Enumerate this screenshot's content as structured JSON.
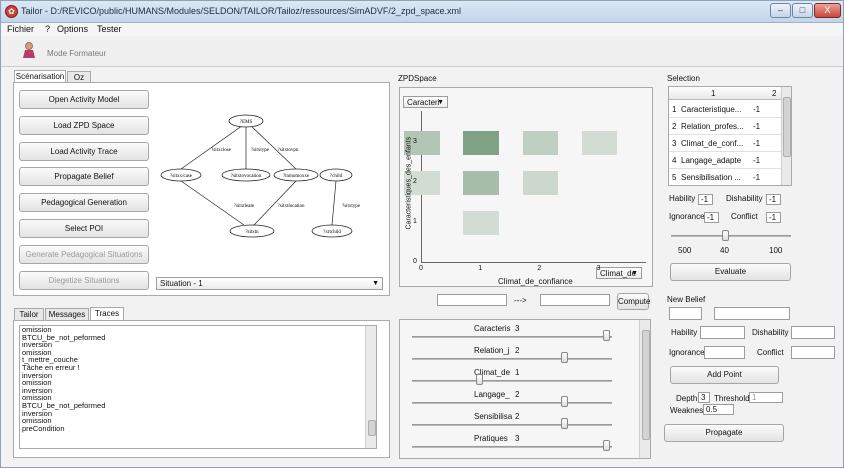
{
  "window": {
    "title": "Tailor - D:/REVICO/public/HUMANS/Modules/SELDON/TAILOR/Tailoz/ressources/SimADVF/2_zpd_space.xml",
    "controls": [
      "–",
      "□",
      "X"
    ]
  },
  "menu": [
    "Fichier",
    "?",
    "Options",
    "Tester"
  ],
  "toolbar": {
    "mode_label": "Mode Formateur"
  },
  "left_tabs": [
    "Scénarisation",
    "Oz"
  ],
  "actions": [
    {
      "label": "Open Activity Model",
      "enabled": true
    },
    {
      "label": "Load ZPD Space",
      "enabled": true
    },
    {
      "label": "Load Activity Trace",
      "enabled": true
    },
    {
      "label": "Propagate Belief",
      "enabled": true
    },
    {
      "label": "Pedagogical Generation",
      "enabled": true
    },
    {
      "label": "Select POI",
      "enabled": true
    },
    {
      "label": "Generate Pedagogical Situations",
      "enabled": false
    },
    {
      "label": "Diegetize Situations",
      "enabled": false
    }
  ],
  "situation_select": "Situation - 1",
  "graph": {
    "nodes": [
      "?EMS",
      "?sitxx/case",
      "?sitxtovocation",
      "?inmomoxxe",
      "?child",
      "?sitxtn",
      "?xrtchild"
    ],
    "edges": [
      "?sitxclose",
      "?sitxtype",
      "?sitxtovpn",
      "?sitxtleate",
      "?sitxtlocation",
      "?sitxtype"
    ]
  },
  "bottom_tabs": [
    "Tailor",
    "Messages",
    "Traces"
  ],
  "traces": [
    "omission",
    "BTCU_be_not_peformed",
    "inversion",
    "omission",
    "t_mettre_couche",
    "Tâche en erreur !",
    "inversion",
    "omission",
    "inversion",
    "omission",
    "BTCU_be_not_peformed",
    "inversion",
    "omission",
    "preCondition"
  ],
  "zpd": {
    "title": "ZPDSpace",
    "ycombo": "Caracteri",
    "xcombo": "Climat_de",
    "ylabel": "Caracteristiques_des_enfants",
    "xlabel": "Climat_de_confiance",
    "xticks": [
      "0",
      "1",
      "2",
      "3"
    ],
    "yticks": [
      "0",
      "1",
      "2",
      "3"
    ],
    "arrow": "--->",
    "compute_label": "Compute",
    "cells": [
      {
        "x": 1,
        "y": 3,
        "level": 0.85
      },
      {
        "x": 2,
        "y": 3,
        "level": 0.35
      },
      {
        "x": 3,
        "y": 3,
        "level": 0.2
      },
      {
        "x": 0,
        "y": 3,
        "level": 0.45
      },
      {
        "x": 1,
        "y": 2,
        "level": 0.55
      },
      {
        "x": 2,
        "y": 2,
        "level": 0.25
      },
      {
        "x": 0,
        "y": 2,
        "level": 0.2
      },
      {
        "x": 1,
        "y": 1,
        "level": 0.2
      }
    ]
  },
  "sliders": [
    {
      "label": "Caracteris",
      "value": "3",
      "pos": 1.0
    },
    {
      "label": "Relation_j",
      "value": "2",
      "pos": 0.67
    },
    {
      "label": "Climat_de",
      "value": "1",
      "pos": 0.0
    },
    {
      "label": "Langage_",
      "value": "2",
      "pos": 0.67
    },
    {
      "label": "Sensibilisa",
      "value": "2",
      "pos": 0.67
    },
    {
      "label": "Pratiques",
      "value": "3",
      "pos": 1.0
    }
  ],
  "selection": {
    "title": "Selection",
    "headers": [
      "1",
      "2"
    ],
    "rows": [
      {
        "num": "1",
        "name": "Caracteristique...",
        "val": "-1"
      },
      {
        "num": "2",
        "name": "Relation_profes...",
        "val": "-1"
      },
      {
        "num": "3",
        "name": "Climat_de_conf...",
        "val": "-1"
      },
      {
        "num": "4",
        "name": "Langage_adapte",
        "val": "-1"
      },
      {
        "num": "5",
        "name": "Sensibilisation ...",
        "val": "-1"
      }
    ],
    "hability_label": "Hability",
    "hability": "-1",
    "dishability_label": "Dishability",
    "dishability": "-1",
    "ignorance_label": "Ignorance",
    "ignorance": "-1",
    "conflict_label": "Conflict",
    "conflict": "-1",
    "range": {
      "min": "500",
      "mid": "40",
      "max": "100",
      "pos": 0.45
    },
    "evaluate_label": "Evaluate"
  },
  "new_belief": {
    "title": "New Belief",
    "hability_label": "Hability",
    "dishability_label": "Dishability",
    "ignorance_label": "Ignorance",
    "conflict_label": "Conflict",
    "add_point_label": "Add Point",
    "depth_label": "Depth",
    "depth": "3",
    "threshold_label": "Threshold",
    "threshold": "1",
    "weakness_label": "Weakness",
    "weakness": "0.5",
    "propagate_label": "Propagate"
  }
}
